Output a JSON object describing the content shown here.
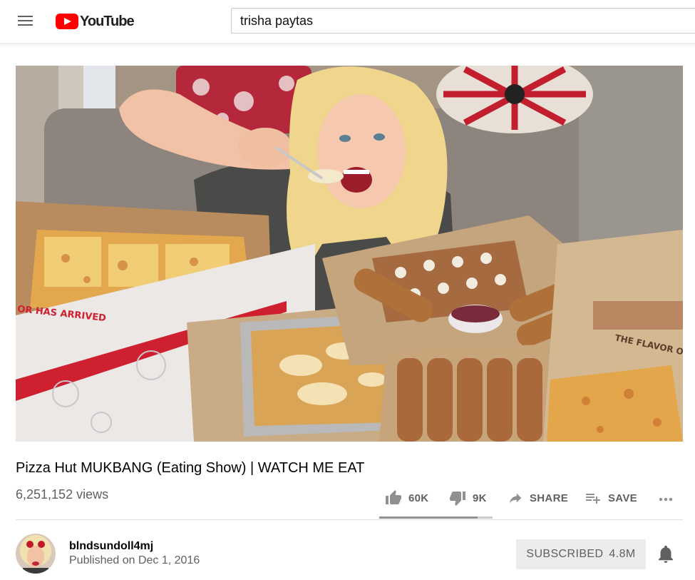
{
  "header": {
    "logo_text": "YouTube",
    "search_value": "trisha paytas"
  },
  "video": {
    "thumbnail_text_box_left": "OR HAS ARRIVED",
    "thumbnail_text_box_right": "THE FLAVOR OF",
    "title": "Pizza Hut MUKBANG (Eating Show) | WATCH ME EAT",
    "views": "6,251,152 views",
    "likes": "60K",
    "dislikes": "9K",
    "like_fraction": 0.87,
    "share_label": "SHARE",
    "save_label": "SAVE"
  },
  "owner": {
    "channel_name": "blndsundoll4mj",
    "published": "Published on Dec 1, 2016",
    "subscribe_label": "SUBSCRIBED",
    "subscriber_count": "4.8M"
  },
  "colors": {
    "brand_red": "#ff0000",
    "text_secondary": "#606060",
    "icon_grey": "#909090"
  }
}
